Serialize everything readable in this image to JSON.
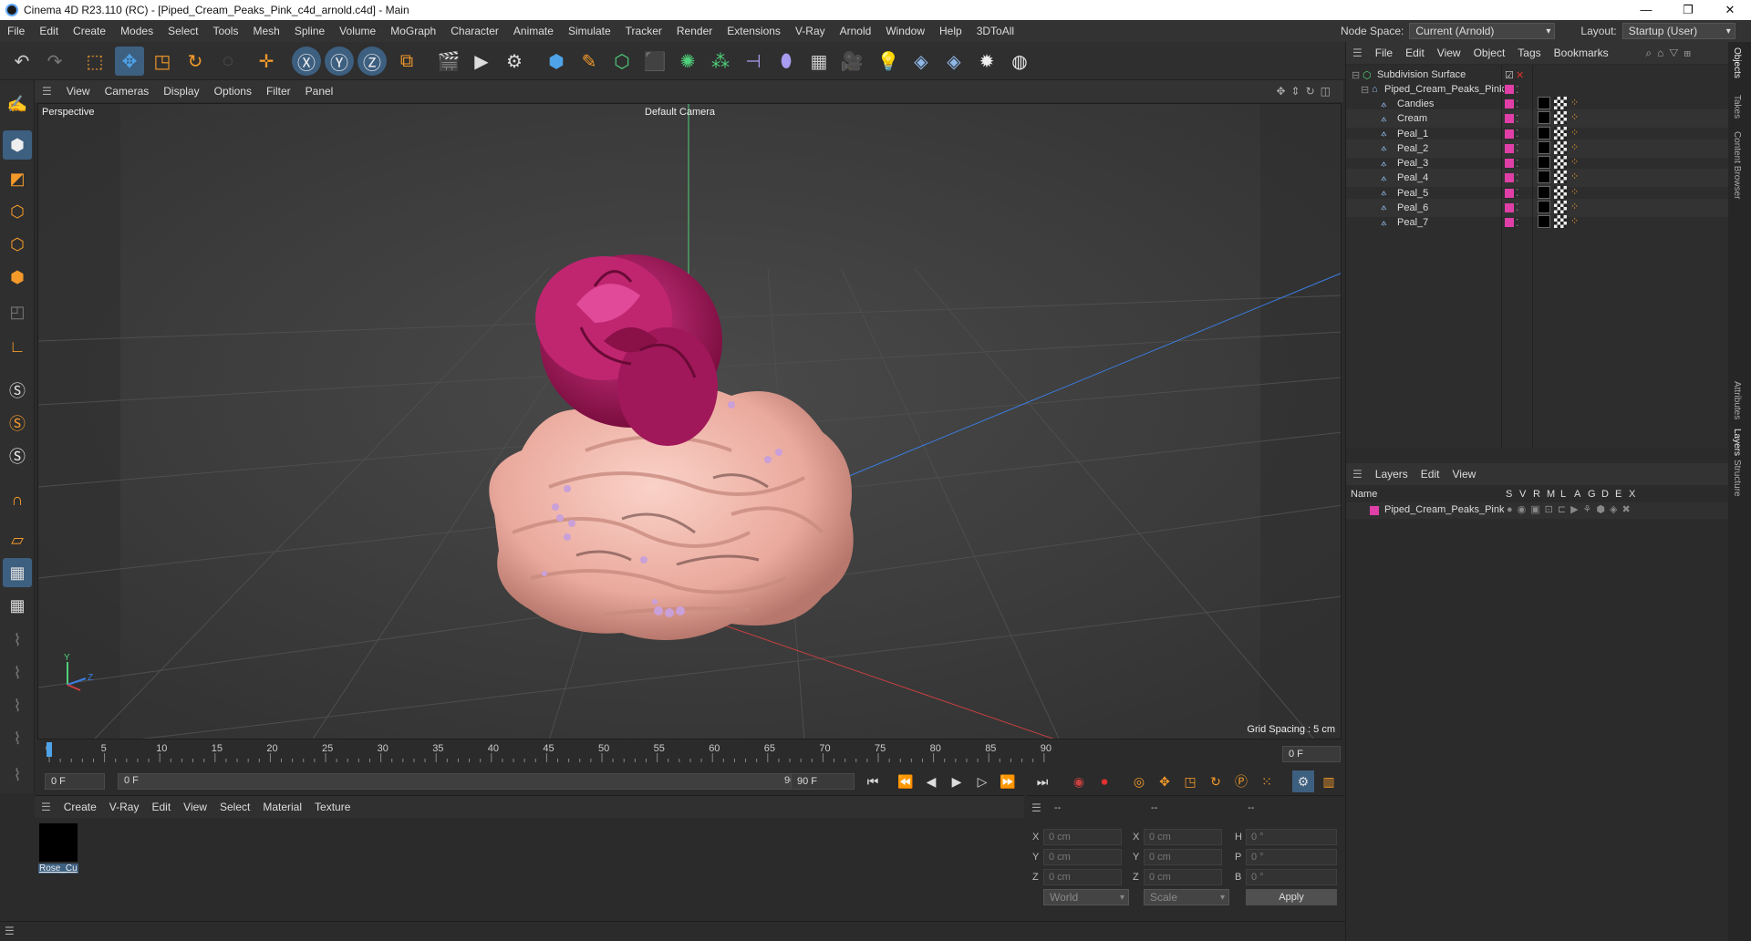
{
  "window": {
    "title": "Cinema 4D R23.110 (RC) - [Piped_Cream_Peaks_Pink_c4d_arnold.c4d] - Main",
    "controls": [
      "—",
      "❐",
      "✕"
    ]
  },
  "menubar": {
    "items": [
      "File",
      "Edit",
      "Create",
      "Modes",
      "Select",
      "Tools",
      "Mesh",
      "Spline",
      "Volume",
      "MoGraph",
      "Character",
      "Animate",
      "Simulate",
      "Tracker",
      "Render",
      "Extensions",
      "V-Ray",
      "Arnold",
      "Window",
      "Help",
      "3DToAll"
    ]
  },
  "nodespace": {
    "label": "Node Space:",
    "value": "Current (Arnold)"
  },
  "layout": {
    "label": "Layout:",
    "value": "Startup (User)"
  },
  "viewport": {
    "menu": [
      "View",
      "Cameras",
      "Display",
      "Options",
      "Filter",
      "Panel"
    ],
    "name": "Perspective",
    "camera": "Default Camera",
    "grid_spacing": "Grid Spacing : 5 cm"
  },
  "timeline": {
    "ticks": [
      "0",
      "5",
      "10",
      "15",
      "20",
      "25",
      "30",
      "35",
      "40",
      "45",
      "50",
      "55",
      "60",
      "65",
      "70",
      "75",
      "80",
      "85",
      "90"
    ],
    "current_frame": "0 F",
    "start": "0 F",
    "range_start": "0 F",
    "range_end": "90 F",
    "end": "90 F"
  },
  "material_panel": {
    "menu": [
      "Create",
      "V-Ray",
      "Edit",
      "View",
      "Select",
      "Material",
      "Texture"
    ],
    "materials": [
      {
        "name": "Rose_Cu"
      }
    ]
  },
  "coord_panel": {
    "header": [
      "--",
      "--",
      "--"
    ],
    "rows": [
      {
        "a": "X",
        "av": "0 cm",
        "b": "X",
        "bv": "0 cm",
        "c": "H",
        "cv": "0 °"
      },
      {
        "a": "Y",
        "av": "0 cm",
        "b": "Y",
        "bv": "0 cm",
        "c": "P",
        "cv": "0 °"
      },
      {
        "a": "Z",
        "av": "0 cm",
        "b": "Z",
        "bv": "0 cm",
        "c": "B",
        "cv": "0 °"
      }
    ],
    "space": "World",
    "mode": "Scale",
    "apply": "Apply"
  },
  "object_manager": {
    "menu": [
      "File",
      "Edit",
      "View",
      "Object",
      "Tags",
      "Bookmarks"
    ],
    "objects": [
      {
        "name": "Subdivision Surface",
        "level": 0
      },
      {
        "name": "Piped_Cream_Peaks_Pink",
        "level": 1
      },
      {
        "name": "Candies",
        "level": 2
      },
      {
        "name": "Cream",
        "level": 2
      },
      {
        "name": "Peal_1",
        "level": 2
      },
      {
        "name": "Peal_2",
        "level": 2
      },
      {
        "name": "Peal_3",
        "level": 2
      },
      {
        "name": "Peal_4",
        "level": 2
      },
      {
        "name": "Peal_5",
        "level": 2
      },
      {
        "name": "Peal_6",
        "level": 2
      },
      {
        "name": "Peal_7",
        "level": 2
      }
    ]
  },
  "layer_manager": {
    "menu": [
      "Layers",
      "Edit",
      "View"
    ],
    "columns": {
      "name": "Name",
      "flags": [
        "S",
        "V",
        "R",
        "M",
        "L",
        "A",
        "G",
        "D",
        "E",
        "X"
      ]
    },
    "layers": [
      {
        "name": "Piped_Cream_Peaks_Pink",
        "color": "#e03fa7"
      }
    ]
  },
  "side_tabs": [
    "Objects",
    "Takes",
    "Content Browser",
    "Attributes",
    "Layers",
    "Structure"
  ],
  "colors": {
    "accent": "#3d5f80",
    "layer_pink": "#e03fa7",
    "cream": "#f2b8ae",
    "rose": "#b5175f"
  }
}
